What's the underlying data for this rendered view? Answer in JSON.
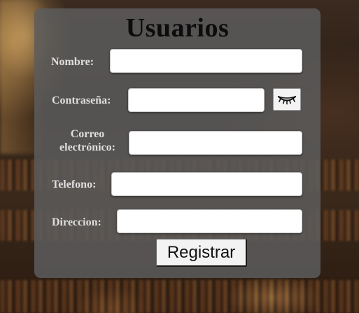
{
  "form": {
    "title": "Usuarios",
    "fields": {
      "nombre": {
        "label": "Nombre:",
        "value": "",
        "placeholder": ""
      },
      "contrasena": {
        "label": "Contraseña:",
        "value": "",
        "placeholder": ""
      },
      "correo": {
        "label_line1": "Correo",
        "label_line2": "electrónico:",
        "value": "",
        "placeholder": ""
      },
      "telefono": {
        "label": "Telefono:",
        "value": "",
        "placeholder": ""
      },
      "direccion": {
        "label": "Direccion:",
        "value": "",
        "placeholder": ""
      }
    },
    "toggle_password_icon": "closed-eye-icon",
    "submit_label": "Registrar"
  },
  "colors": {
    "card_background": "#5c5c5c",
    "title": "#0c0c0c",
    "label": "#dedede"
  }
}
